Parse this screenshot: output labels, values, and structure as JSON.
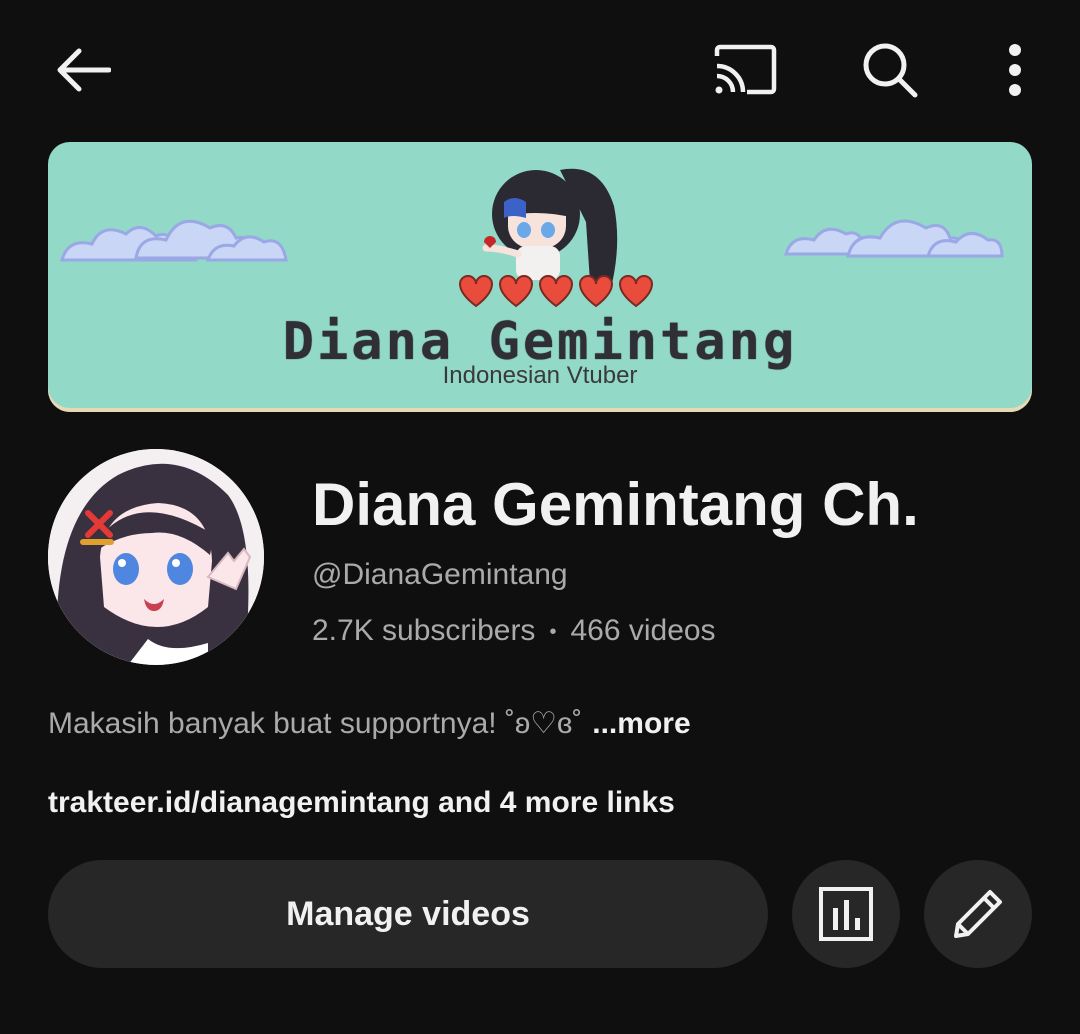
{
  "header": {
    "icons": [
      "back-arrow-icon",
      "cast-icon",
      "search-icon",
      "more-vert-icon"
    ]
  },
  "banner": {
    "title": "Diana Gemintang",
    "subtitle": "Indonesian Vtuber",
    "background": "#92d9c8"
  },
  "channel": {
    "name": "Diana Gemintang Ch.",
    "handle": "@DianaGemintang",
    "subscribers": "2.7K subscribers",
    "separator": "•",
    "videos": "466 videos",
    "description": "Makasih banyak buat supportnya! ˚ʚ♡ɞ˚",
    "more_label": "...more",
    "links": "trakteer.id/dianagemintang and 4 more links"
  },
  "actions": {
    "manage_label": "Manage videos",
    "analytics_icon": "analytics-icon",
    "edit_icon": "pencil-icon"
  },
  "colors": {
    "background": "#0f0f0f",
    "button_bg": "#272727",
    "text_primary": "#f1f1f1",
    "text_secondary": "#aaaaaa"
  }
}
